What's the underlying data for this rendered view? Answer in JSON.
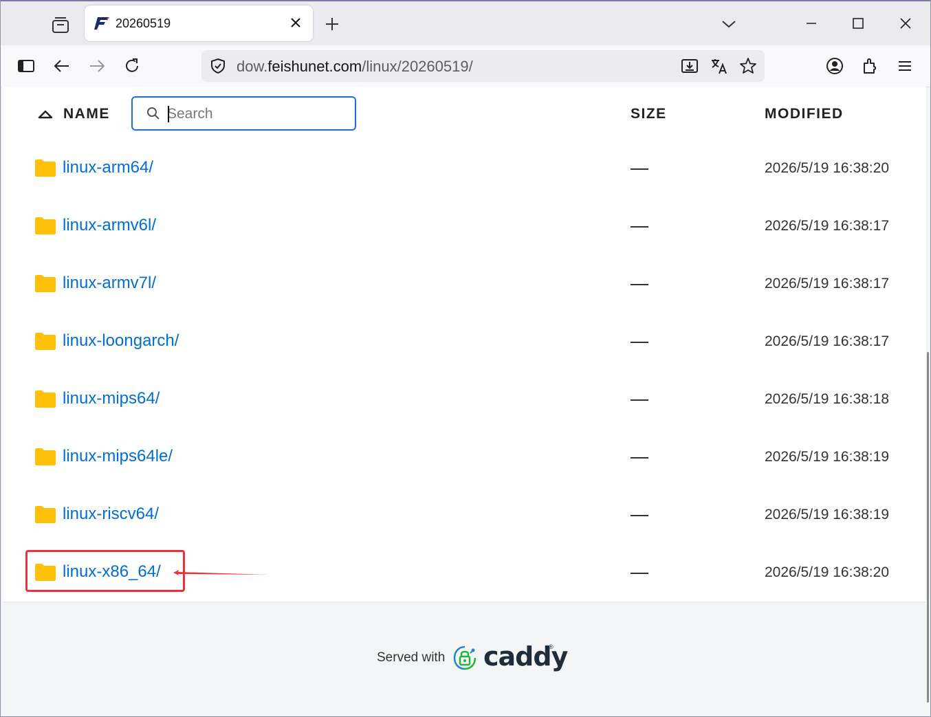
{
  "browser": {
    "tab_title": "20260519",
    "url_prefix": "dow.",
    "url_host": "feishunet.com",
    "url_path": "/linux/20260519/"
  },
  "table": {
    "col_name": "NAME",
    "col_size": "SIZE",
    "col_modified": "MODIFIED",
    "search_placeholder": "Search",
    "rows": [
      {
        "name": "linux-arm64/",
        "size": "—",
        "modified": "2026/5/19 16:38:20"
      },
      {
        "name": "linux-armv6l/",
        "size": "—",
        "modified": "2026/5/19 16:38:17"
      },
      {
        "name": "linux-armv7l/",
        "size": "—",
        "modified": "2026/5/19 16:38:17"
      },
      {
        "name": "linux-loongarch/",
        "size": "—",
        "modified": "2026/5/19 16:38:17"
      },
      {
        "name": "linux-mips64/",
        "size": "—",
        "modified": "2026/5/19 16:38:18"
      },
      {
        "name": "linux-mips64le/",
        "size": "—",
        "modified": "2026/5/19 16:38:19"
      },
      {
        "name": "linux-riscv64/",
        "size": "—",
        "modified": "2026/5/19 16:38:19"
      },
      {
        "name": "linux-x86_64/",
        "size": "—",
        "modified": "2026/5/19 16:38:20"
      }
    ]
  },
  "footer": {
    "served_with": "Served with",
    "brand": "caddy"
  },
  "colors": {
    "link": "#006ed3",
    "folder": "#ffc107",
    "highlight": "#e8333a",
    "search_border": "#1d6fd6"
  },
  "icons": [
    "tab-list-icon",
    "favicon-icon",
    "close-icon",
    "plus-icon",
    "chevron-down-icon",
    "minimize-icon",
    "maximize-icon",
    "sidebar-icon",
    "back-icon",
    "forward-icon",
    "reload-icon",
    "shield-icon",
    "download-icon",
    "translate-icon",
    "star-icon",
    "account-icon",
    "extensions-icon",
    "menu-icon",
    "sort-up-icon",
    "search-icon",
    "folder-icon",
    "caddy-logo-icon"
  ]
}
